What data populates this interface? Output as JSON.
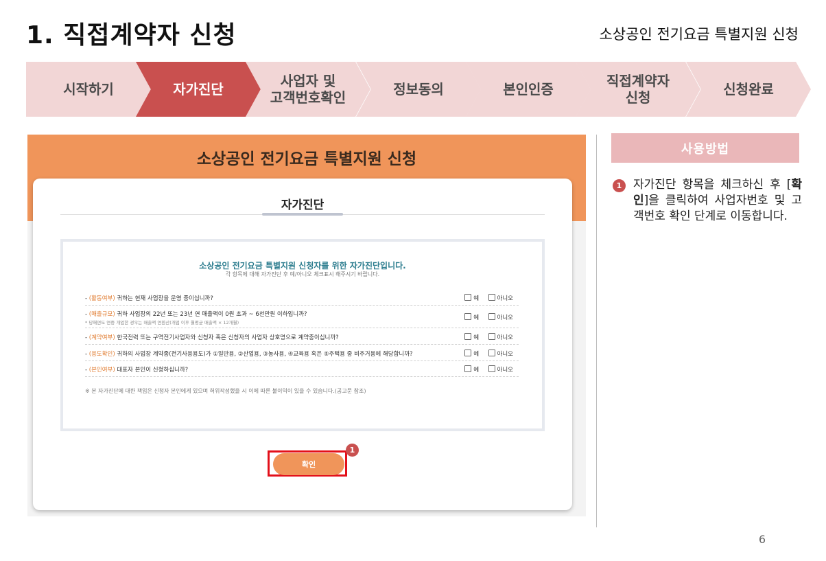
{
  "header": {
    "title": "1. 직접계약자 신청",
    "subtitle": "소상공인 전기요금 특별지원 신청"
  },
  "steps": [
    {
      "label": "시작하기"
    },
    {
      "label": "자가진단",
      "active": true
    },
    {
      "label": "사업자 및\n고객번호확인"
    },
    {
      "label": "정보동의"
    },
    {
      "label": "본인인증"
    },
    {
      "label": "직접계약자\n신청"
    },
    {
      "label": "신청완료"
    }
  ],
  "screen": {
    "banner_title": "소상공인 전기요금 특별지원 신청",
    "card_title": "자가진단",
    "heading": "소상공인 전기요금 특별지원 신청자를 위한 자가진단입니다.",
    "subheading": "각 항목에 대해 자가진단 후 예/아니오 체크표시 해주시기 바랍니다.",
    "yes_label": "예",
    "no_label": "아니오",
    "questions": [
      {
        "tag": "(활동여부)",
        "text": "귀하는 현재 사업장을 운영 중이십니까?",
        "note": ""
      },
      {
        "tag": "(매출규모)",
        "text": "귀하 사업장의 22년 또는 23년 연 매출액이 0원 초과 ~ 6천만원 이하입니까?",
        "note": "* 당해연도 연중 개업한 경우는 매출액 연환산(개업 이후 월평균 매출액 × 12개월)"
      },
      {
        "tag": "(계약여부)",
        "text": "한국전력 또는 구역전기사업자와 신청자 혹은 신청자의 사업자 상호명으로 계약중이십니까?",
        "note": ""
      },
      {
        "tag": "(용도확인)",
        "text": "귀하의 사업장 계약종(전기사용용도)가 ①일반용, ②산업용, ③농사용, ④교육용 혹은 ⑤주택용 중 비주거용에 해당합니까?",
        "note": ""
      },
      {
        "tag": "(본인여부)",
        "text": "대표자 본인이 신청하십니까?",
        "note": ""
      }
    ],
    "footnote": "※ 본 자가진단에 대한 책임은 신청자 본인에게 있으며 허위작성했을 시 이에 따른 불이익이 있을 수 있습니다.(공고문 참조)",
    "confirm_label": "확인",
    "marker": "1"
  },
  "help": {
    "title": "사용방법",
    "marker": "1",
    "text_before": "자가진단 항목을 체크하신 후 [",
    "text_bold": "확인",
    "text_after": "]을 클릭하여 사업자번호 및 고객번호 확인 단계로 이동합니다."
  },
  "page_number": "6",
  "colors": {
    "accent": "#c9504f",
    "step_inactive": "#f2d6d6",
    "banner": "#f0955a",
    "help_header": "#eab7b9",
    "highlight_border": "#e3101a"
  }
}
